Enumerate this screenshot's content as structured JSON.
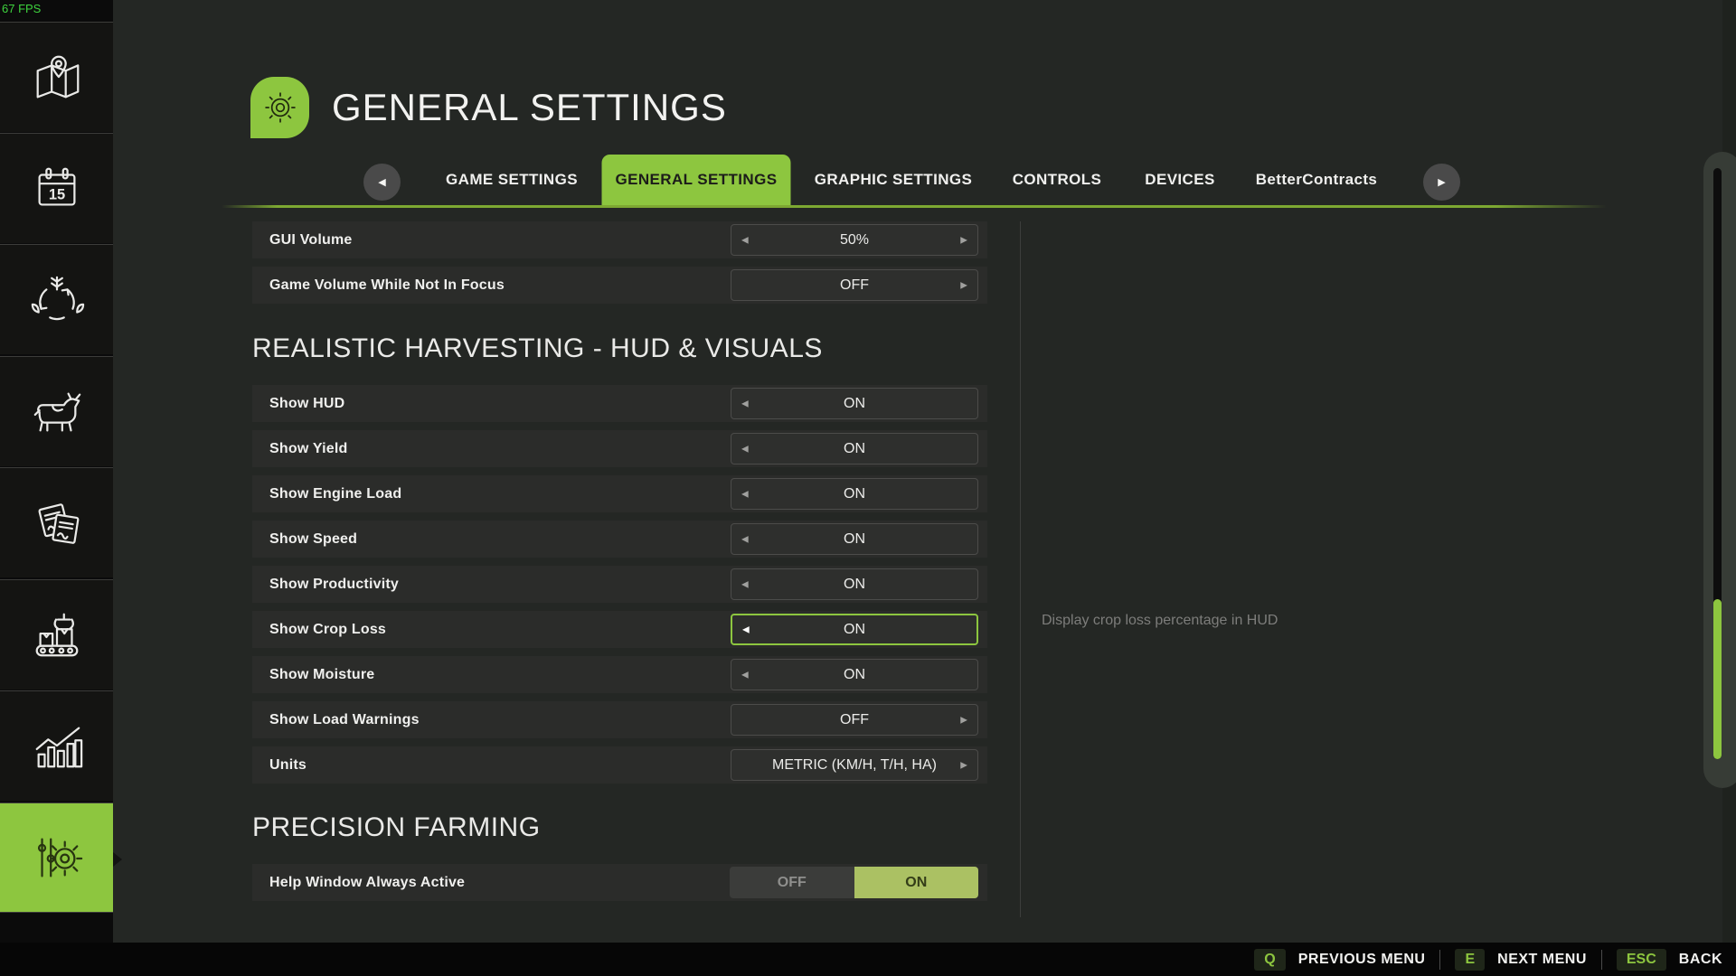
{
  "hud": {
    "fps": "67 FPS"
  },
  "colors": {
    "accent": "#8dc63f",
    "fps_green": "#3ed33e",
    "toggle_on_bg": "#abc163"
  },
  "icons": {
    "arrow_left": "◀",
    "arrow_right": "▶",
    "sidebar": [
      "map-icon",
      "calendar-icon",
      "crop-rotation-icon",
      "animals-icon",
      "contracts-icon",
      "production-icon",
      "statistics-icon",
      "settings-icon"
    ]
  },
  "sidebar": {
    "calendar_day": "15"
  },
  "header": {
    "title": "GENERAL SETTINGS"
  },
  "tabs": {
    "items": [
      {
        "label": "GAME SETTINGS",
        "active": false
      },
      {
        "label": "GENERAL SETTINGS",
        "active": true
      },
      {
        "label": "GRAPHIC SETTINGS",
        "active": false
      },
      {
        "label": "CONTROLS",
        "active": false
      },
      {
        "label": "DEVICES",
        "active": false
      },
      {
        "label": "BetterContracts",
        "active": false
      }
    ]
  },
  "settings": {
    "sections": [
      {
        "title": "REALISTIC HARVESTING - HUD & VISUALS"
      },
      {
        "title": "PRECISION FARMING"
      }
    ],
    "rows": [
      {
        "label": "GUI Volume",
        "value": "50%",
        "arrows": "both",
        "selected": false
      },
      {
        "label": "Game Volume While Not In Focus",
        "value": "OFF",
        "arrows": "right",
        "selected": false
      },
      {
        "label": "Show HUD",
        "value": "ON",
        "arrows": "left",
        "selected": false
      },
      {
        "label": "Show Yield",
        "value": "ON",
        "arrows": "left",
        "selected": false
      },
      {
        "label": "Show Engine Load",
        "value": "ON",
        "arrows": "left",
        "selected": false
      },
      {
        "label": "Show Speed",
        "value": "ON",
        "arrows": "left",
        "selected": false
      },
      {
        "label": "Show Productivity",
        "value": "ON",
        "arrows": "left",
        "selected": false
      },
      {
        "label": "Show Crop Loss",
        "value": "ON",
        "arrows": "left",
        "selected": true
      },
      {
        "label": "Show Moisture",
        "value": "ON",
        "arrows": "left",
        "selected": false
      },
      {
        "label": "Show Load Warnings",
        "value": "OFF",
        "arrows": "right",
        "selected": false
      },
      {
        "label": "Units",
        "value": "METRIC (KM/H, T/H, HA)",
        "arrows": "right",
        "selected": false
      }
    ],
    "toggle_row": {
      "label": "Help Window Always Active",
      "off": "OFF",
      "on": "ON",
      "active": "ON"
    }
  },
  "help_panel": {
    "text": "Display crop loss percentage in HUD"
  },
  "footer": {
    "items": [
      {
        "key": "Q",
        "label": "PREVIOUS MENU"
      },
      {
        "key": "E",
        "label": "NEXT MENU"
      },
      {
        "key": "ESC",
        "label": "BACK"
      }
    ]
  }
}
